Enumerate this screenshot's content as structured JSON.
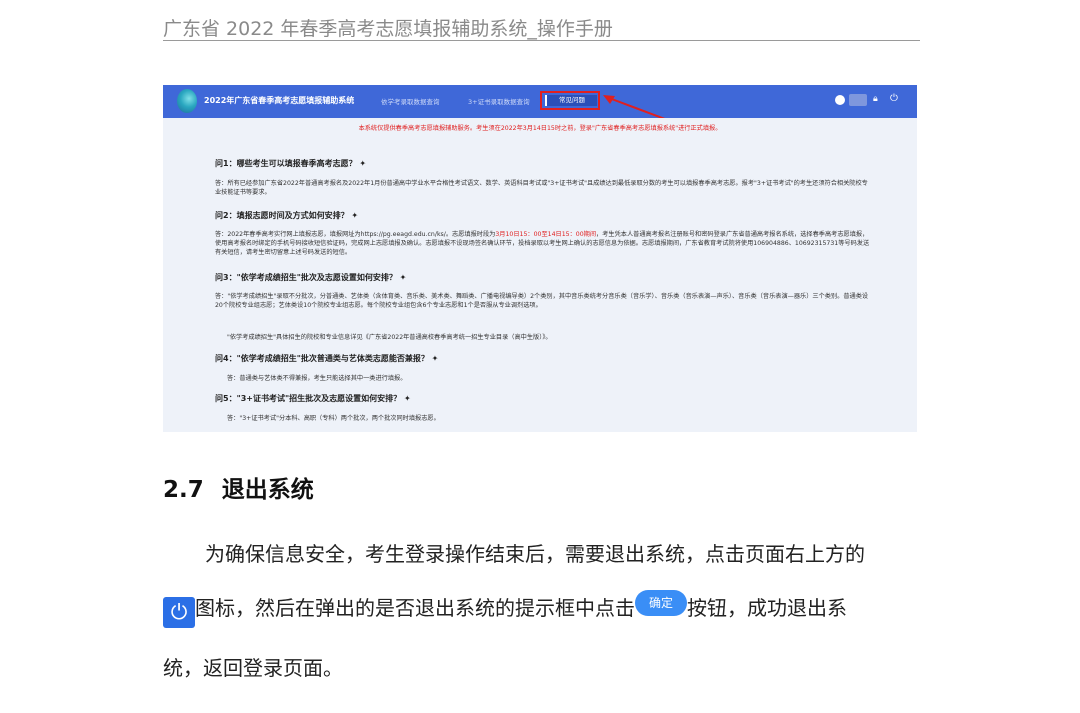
{
  "doc_header": {
    "title": "广东省 2022 年春季高考志愿填报辅助系统_操作手册"
  },
  "screenshot": {
    "app_title": "2022年广东省春季高考志愿填报辅助系统",
    "nav": [
      "依学考录取数据查询",
      "3+证书录取数据查询",
      "常见问题"
    ],
    "notice": "本系统仅提供春季高考志愿填报辅助服务。考生须在2022年3月14日15时之前，登录\"广东省春季高考志愿填报系统\"进行正式填报。",
    "faq": [
      {
        "q": "问1：哪些考生可以填报春季高考志愿？ ✦",
        "a": "答：所有已经参加广东省2022年普通高考报名及2022年1月份普通高中学业水平合格性考试语文、数学、英语科目考试或\"3+证书考试\"且成绩达到最低录取分数的考生可以填报春季高考志愿。报考\"3+证书考试\"的考生还须符合相关院校专业技能证书等要求。"
      },
      {
        "q": "问2：填报志愿时间及方式如何安排？ ✦",
        "a_before": "答：2022年春季高考实行网上填报志愿，填报网址为https://pg.eeagd.edu.cn/ks/。志愿填报时段为",
        "a_red": "3月10日15：00至14日15：00期间",
        "a_after": "，考生凭本人普通高考报名注册账号和密码登录广东省普通高考报名系统，选择春季高考志愿填报，使用高考报名时绑定的手机号码接收短信验证码，完成网上志愿填报及确认。志愿填报不设现场签名确认环节，投档录取以考生网上确认的志愿信息为依据。志愿填报期间，广东省教育考试院将使用106904886、10692315731等号码发送有关短信，请考生密切留意上述号码发送的短信。"
      },
      {
        "q": "问3：\"依学考成绩招生\"批次及志愿设置如何安排？ ✦",
        "a": "答：\"依学考成绩招生\"录取不分批次，分普通类、艺体类（含体育类、音乐类、美术类、舞蹈类、广播电视编导类）2个类别，其中音乐类统考分音乐类（音乐学）、音乐类（音乐表演—声乐）、音乐类（音乐表演—器乐）三个类别。普通类设20个院校专业组志愿；艺体类设10个院校专业组志愿。每个院校专业组包含6个专业志愿和1个是否服从专业调剂选项。",
        "a2": "\"依学考成绩招生\"具体招生的院校和专业信息详见《广东省2022年普通高校春季高考统一招生专业目录（高中生版）》。"
      },
      {
        "q": "问4：\"依学考成绩招生\"批次普通类与艺体类志愿能否兼报？ ✦",
        "a": "答：普通类与艺体类不得兼报，考生只能选择其中一类进行填报。"
      },
      {
        "q": "问5：\"3+证书考试\"招生批次及志愿设置如何安排？ ✦",
        "a": "答：\"3+证书考试\"分本科、高职（专科）两个批次，两个批次同时填报志愿。"
      }
    ]
  },
  "section": {
    "number": "2.7",
    "title": "退出系统"
  },
  "paragraph": {
    "line1": "为确保信息安全，考生登录操作结束后，需要退出系统，点击页面右上方的",
    "line2_a": "图标，然后在弹出的是否退出系统的提示框中点击",
    "confirm_label": "确定",
    "line2_b": "按钮，成功退出系",
    "line3": "统，返回登录页面。"
  },
  "icons": {
    "power": "power-icon",
    "user": "user-icon",
    "lock": "lock-icon"
  }
}
